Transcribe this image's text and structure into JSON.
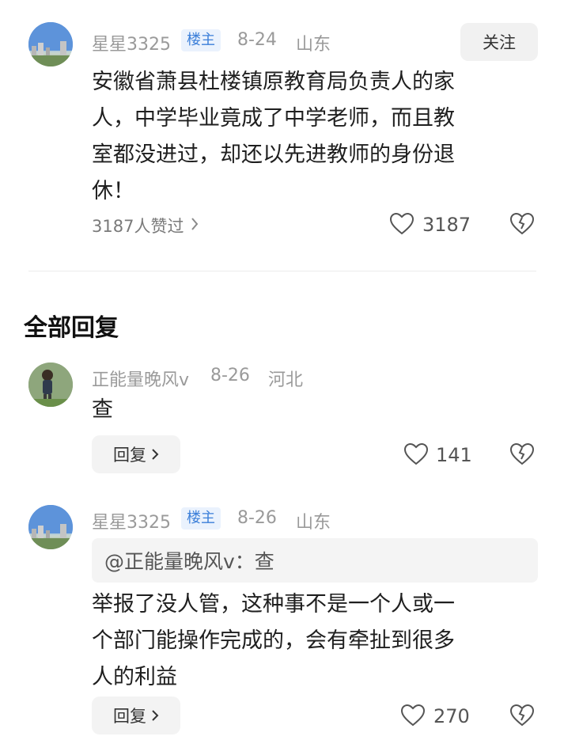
{
  "post": {
    "username": "星星3325",
    "badge": "楼主",
    "date": "8-24",
    "location": "山东",
    "follow_label": "关注",
    "content_lines": [
      "安徽省萧县杜楼镇原教育局负责人的家",
      "人，中学毕业竟成了中学老师，而且教",
      "室都没进过，却还以先进教师的身份退",
      "休！"
    ],
    "likes_text": "3187人赞过",
    "like_count": "3187"
  },
  "section_title": "全部回复",
  "replies": [
    {
      "username": "正能量晚风v",
      "date": "8-26",
      "location": "河北",
      "content_lines": [
        "查"
      ],
      "reply_label": "回复",
      "like_count": "141"
    },
    {
      "username": "星星3325",
      "badge": "楼主",
      "date": "8-26",
      "location": "山东",
      "quote": "@正能量晚风v：查",
      "content_lines": [
        "举报了没人管，这种事不是一个人或一",
        "个部门能操作完成的，会有牵扯到很多",
        "人的利益"
      ],
      "reply_label": "回复",
      "like_count": "270"
    }
  ]
}
